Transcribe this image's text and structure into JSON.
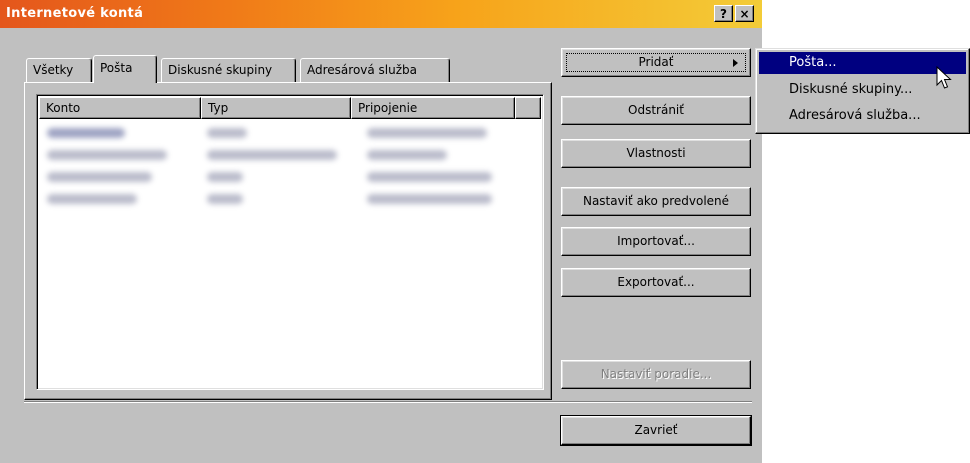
{
  "window": {
    "title": "Internetové kontá",
    "help_button": "?",
    "close_button": "×"
  },
  "tabs": [
    {
      "label": "Všetky",
      "active": false
    },
    {
      "label": "Pošta",
      "active": true
    },
    {
      "label": "Diskusné skupiny",
      "active": false
    },
    {
      "label": "Adresárová služba",
      "active": false
    }
  ],
  "list": {
    "columns": [
      "Konto",
      "Typ",
      "Pripojenie"
    ],
    "rows_blurred": 5
  },
  "buttons": {
    "add": "Pridať",
    "remove": "Odstrániť",
    "properties": "Vlastnosti",
    "set_default": "Nastaviť ako predvolené",
    "import": "Importovať...",
    "export": "Exportovať...",
    "set_order": "Nastaviť poradie...",
    "close": "Zavrieť"
  },
  "add_menu": {
    "items": [
      "Pošta...",
      "Diskusné skupiny...",
      "Adresárová služba..."
    ],
    "highlighted": "Pošta..."
  },
  "colors": {
    "title_start": "#e4561c",
    "title_end": "#f3cc38",
    "highlight": "#000080",
    "face": "#c0c0c0"
  }
}
